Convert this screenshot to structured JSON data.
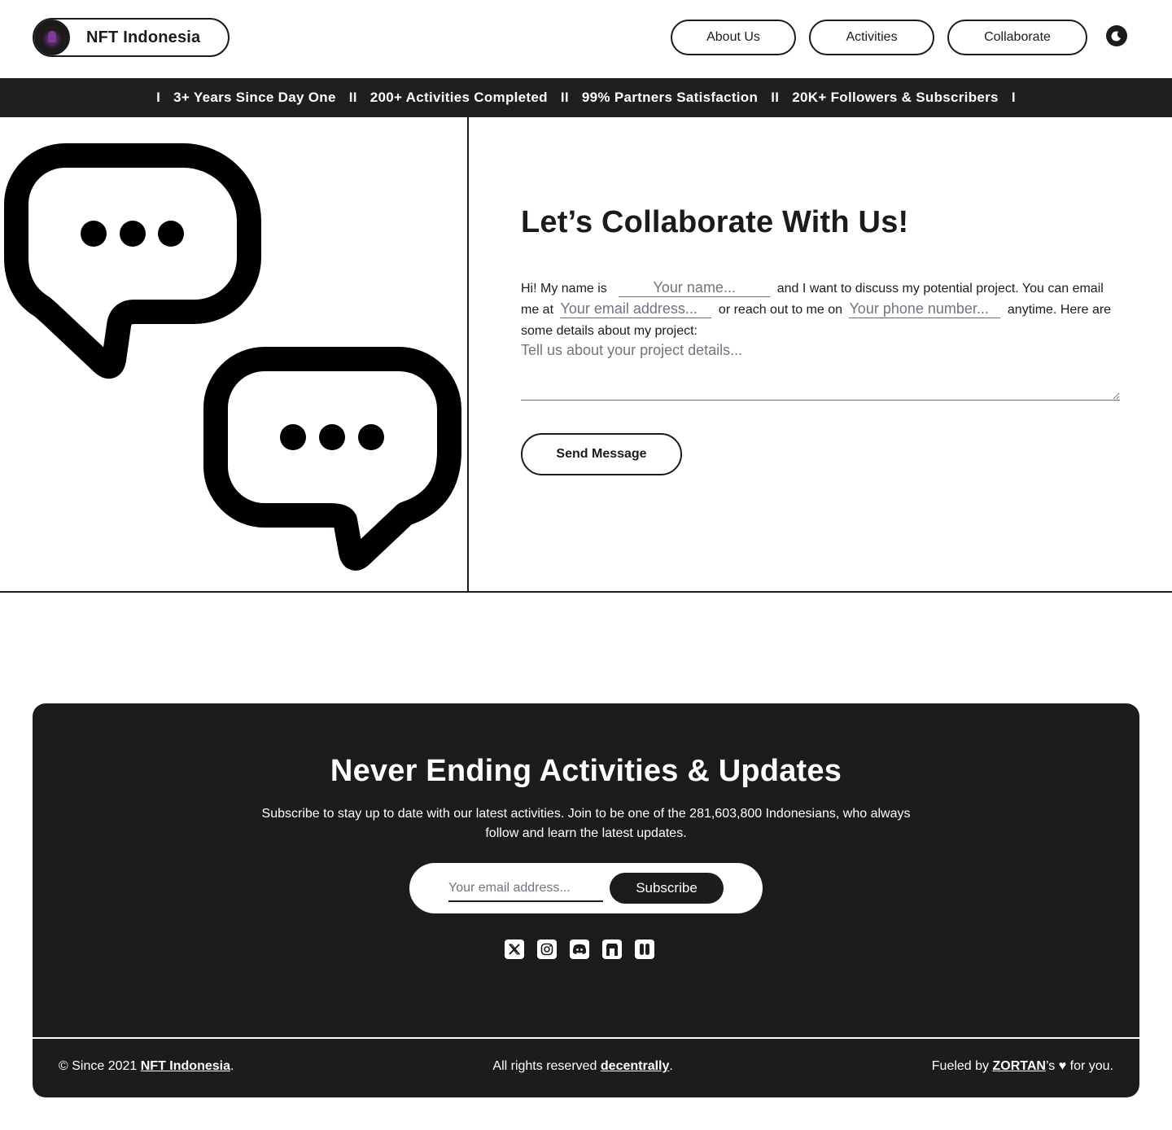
{
  "header": {
    "brand_name": "NFT Indonesia",
    "nav": {
      "about": "About Us",
      "activities": "Activities",
      "collaborate": "Collaborate"
    },
    "theme_toggle_icon": "moon-icon"
  },
  "stats_bar": {
    "separator_edge": "I",
    "separator_mid": "II",
    "items": [
      "3+ Years Since Day One",
      "200+ Activities Completed",
      "99% Partners Satisfaction",
      "20K+ Followers & Subscribers"
    ]
  },
  "hero": {
    "illustration_icon": "chat-bubbles-icon",
    "title": "Let’s Collaborate With Us!",
    "form": {
      "text_1": "Hi! My name is",
      "name_placeholder": "Your name...",
      "text_2": "and I want to discuss my potential project. You can email me at",
      "email_placeholder": "Your email address...",
      "text_3": "or reach out to me on",
      "phone_placeholder": "Your phone number...",
      "text_4": "anytime. Here are some details about my project:",
      "details_placeholder": "Tell us about your project details...",
      "send_label": "Send Message"
    }
  },
  "footer": {
    "title": "Never Ending Activities & Updates",
    "subtitle": "Subscribe to stay up to date with our latest activities. Join to be one of the 281,603,800 Indonesians, who always follow and learn the latest updates.",
    "email_placeholder": "Your email address...",
    "subscribe_label": "Subscribe",
    "socials": [
      "x-icon",
      "instagram-icon",
      "discord-icon",
      "opensea-icon",
      "link3-icon"
    ],
    "copyright_prefix": "© Since 2021",
    "copyright_link": "NFT Indonesia",
    "rights_prefix": "All rights reserved",
    "rights_link": "decentrally",
    "fueled_prefix": "Fueled by",
    "fueled_link": "ZORTAN",
    "fueled_suffix": "’s ♥ for you.",
    "period": "."
  }
}
